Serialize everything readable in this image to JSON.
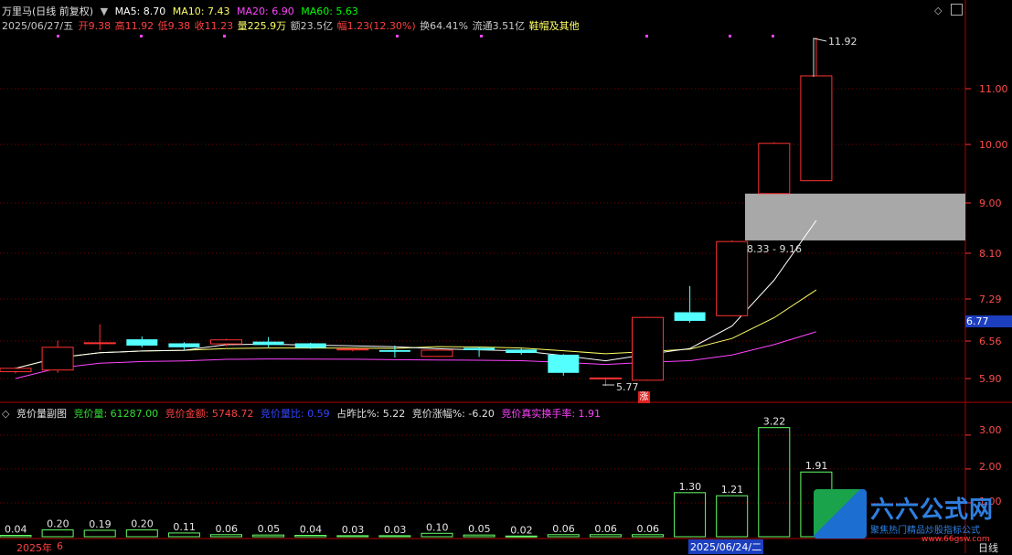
{
  "header": {
    "title": "万里马(日线 前复权)",
    "ma5": "MA5: 8.70",
    "ma10": "MA10: 7.43",
    "ma20": "MA20: 6.90",
    "ma60": "MA60: 5.63"
  },
  "quote": {
    "date": "2025/06/27/五",
    "open": "开9.38",
    "high": "高11.92",
    "low": "低9.38",
    "close": "收11.23",
    "volume": "量225.9万",
    "amount": "额23.5亿",
    "change": "幅1.23(12.30%)",
    "turnover": "换64.41%",
    "float": "流通3.51亿",
    "extra": "鞋帽及其他"
  },
  "price_axis": {
    "ticks": [
      "11.00",
      "10.00",
      "9.00",
      "8.10",
      "7.29",
      "6.56",
      "5.90"
    ],
    "current": "6.77"
  },
  "price_annotations": {
    "high_label": "11.92",
    "low_label": "5.77",
    "zone_label": "8.33 - 9.16",
    "limit_up_marker": "涨"
  },
  "lower_header": {
    "title": "竞价量副图",
    "jjl": "竞价量: 61287.00",
    "jjje": "竞价金额: 5748.72",
    "jjlb": "竞价量比: 0.59",
    "zzb": "占昨比%: 5.22",
    "jjzf": "竞价涨幅%: -6.20",
    "hsl": "竞价真实换手率: 1.91"
  },
  "lower_axis": {
    "ticks": [
      "3.00",
      "2.00",
      "1.00"
    ]
  },
  "bottom": {
    "year_label": "2025年",
    "month_label": "6",
    "cursor_date": "2025/06/24/二",
    "period": "日线"
  },
  "watermark": {
    "brand": "六六公式网",
    "slogan": "聚焦热门精品炒股指标公式",
    "url": "www.66gsw.com"
  },
  "colors": {
    "background": "#000000",
    "up": "#ff3232",
    "down": "#54ffff",
    "ma5": "#ffffff",
    "ma10": "#ffff66",
    "ma20": "#ff44ff",
    "ma60": "#00ff00",
    "grid": "#7a0000",
    "volume_bar": "#66ff66"
  },
  "chart_data": [
    {
      "type": "candlestick",
      "title": "万里马(日线 前复权)",
      "candles": [
        {
          "o": 6.02,
          "c": 6.08,
          "h": 6.1,
          "l": 5.99
        },
        {
          "o": 6.05,
          "c": 6.45,
          "h": 6.57,
          "l": 6.0
        },
        {
          "o": 6.53,
          "c": 6.53,
          "h": 6.85,
          "l": 6.4
        },
        {
          "o": 6.59,
          "c": 6.48,
          "h": 6.64,
          "l": 6.45
        },
        {
          "o": 6.52,
          "c": 6.45,
          "h": 6.54,
          "l": 6.4
        },
        {
          "o": 6.51,
          "c": 6.58,
          "h": 6.6,
          "l": 6.47
        },
        {
          "o": 6.55,
          "c": 6.49,
          "h": 6.63,
          "l": 6.45
        },
        {
          "o": 6.52,
          "c": 6.44,
          "h": 6.53,
          "l": 6.42
        },
        {
          "o": 6.42,
          "c": 6.42,
          "h": 6.43,
          "l": 6.38
        },
        {
          "o": 6.4,
          "c": 6.37,
          "h": 6.48,
          "l": 6.27
        },
        {
          "o": 6.29,
          "c": 6.4,
          "h": 6.42,
          "l": 6.28
        },
        {
          "o": 6.44,
          "c": 6.4,
          "h": 6.46,
          "l": 6.28
        },
        {
          "o": 6.41,
          "c": 6.35,
          "h": 6.44,
          "l": 6.32
        },
        {
          "o": 6.32,
          "c": 6.0,
          "h": 6.33,
          "l": 5.95
        },
        {
          "o": 5.91,
          "c": 5.91,
          "h": 5.92,
          "l": 5.77
        },
        {
          "o": 5.87,
          "c": 6.97,
          "h": 6.98,
          "l": 5.86
        },
        {
          "o": 7.06,
          "c": 6.91,
          "h": 7.52,
          "l": 6.88
        },
        {
          "o": 7.0,
          "c": 8.31,
          "h": 8.33,
          "l": 7.0
        },
        {
          "o": 9.16,
          "c": 10.02,
          "h": 10.04,
          "l": 9.16
        },
        {
          "o": 9.38,
          "c": 11.23,
          "h": 11.92,
          "l": 9.38
        }
      ],
      "ma5_tail": 8.7,
      "ma10_tail": 7.43,
      "ma20_tail": 6.9,
      "zone": [
        8.33,
        9.16
      ],
      "yticks": [
        11.0,
        10.0,
        9.0,
        8.1,
        7.29,
        6.56,
        5.9
      ]
    },
    {
      "type": "bar",
      "title": "竞价量副图",
      "values": [
        0.04,
        0.2,
        0.19,
        0.2,
        0.11,
        0.06,
        0.05,
        0.04,
        0.03,
        0.03,
        0.1,
        0.05,
        0.02,
        0.06,
        0.06,
        0.06,
        1.3,
        1.21,
        3.22,
        1.91
      ],
      "labels": [
        "0.04",
        "0.20",
        "0.19",
        "0.20",
        "0.11",
        "0.06",
        "0.05",
        "0.04",
        "0.03",
        "0.03",
        "0.10",
        "0.05",
        "0.02",
        "0.06",
        "0.06",
        "0.06",
        "1.30",
        "1.21",
        "3.22",
        "1.91"
      ],
      "ylim": [
        0,
        3.6
      ],
      "yticks": [
        3.0,
        2.0,
        1.0
      ]
    }
  ]
}
